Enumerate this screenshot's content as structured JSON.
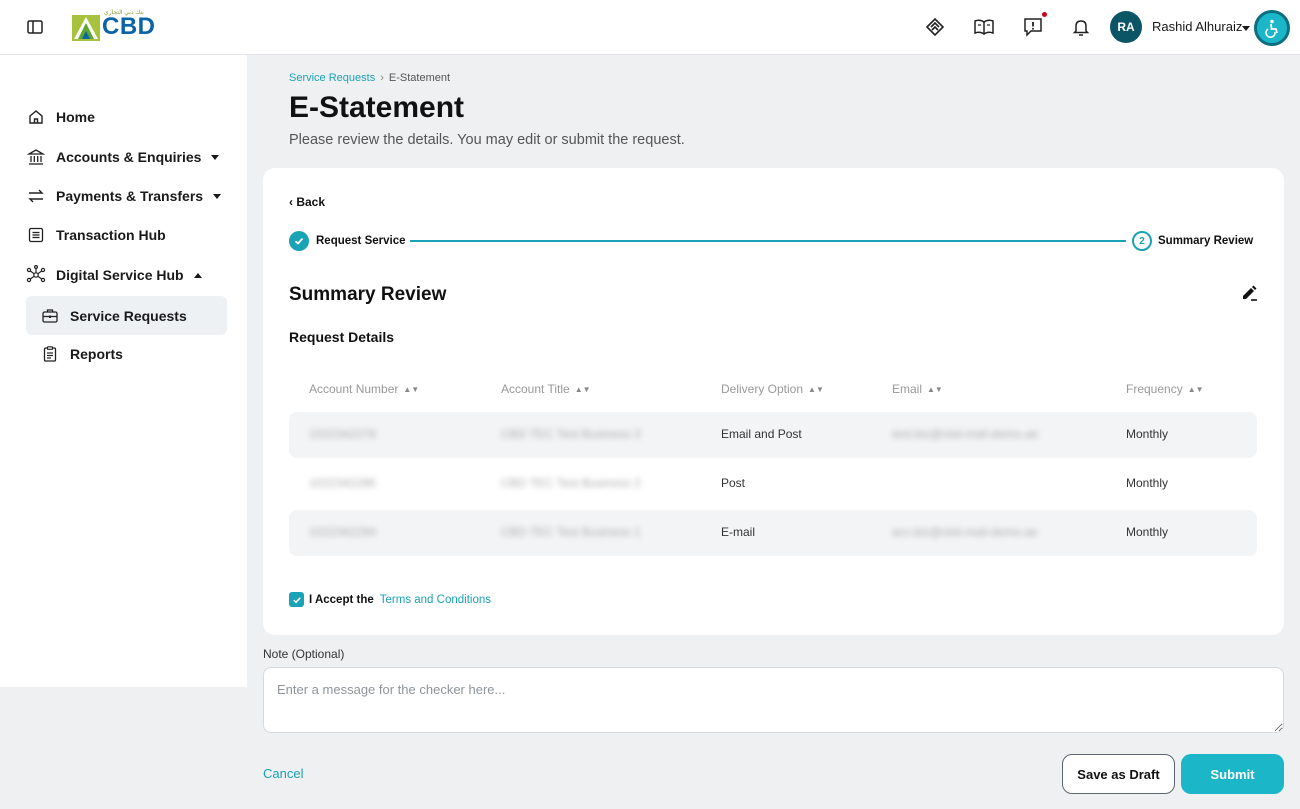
{
  "header": {
    "logo_text": "CBD",
    "logo_subtext": "بنك دبي التجاري",
    "user_initials": "RA",
    "user_name": "Rashid Alhuraiz",
    "icons": [
      "sidebar-toggle-icon",
      "handshake-icon",
      "book-icon",
      "feedback-icon",
      "bell-icon",
      "accessibility-icon"
    ]
  },
  "sidebar": {
    "items": [
      {
        "label": "Home",
        "icon": "home-icon"
      },
      {
        "label": "Accounts & Enquiries",
        "icon": "bank-icon",
        "expandable": true
      },
      {
        "label": "Payments & Transfers",
        "icon": "transfer-icon",
        "expandable": true
      },
      {
        "label": "Transaction Hub",
        "icon": "list-icon"
      },
      {
        "label": "Digital Service Hub",
        "icon": "network-icon",
        "expanded": true
      },
      {
        "label": "Service Requests",
        "icon": "briefcase-icon",
        "active": true
      },
      {
        "label": "Reports",
        "icon": "clipboard-icon"
      }
    ]
  },
  "breadcrumb": {
    "parent": "Service Requests",
    "separator": "›",
    "current": "E-Statement"
  },
  "page": {
    "title": "E-Statement",
    "subtitle": "Please review the details. You may edit or submit the request."
  },
  "card": {
    "back_label": "‹ Back",
    "stepper": {
      "step1_label": "Request Service",
      "step2_number": "2",
      "step2_label": "Summary Review"
    },
    "section_title": "Summary Review",
    "sub_title": "Request Details",
    "table": {
      "headers": [
        "Account Number",
        "Account Title",
        "Delivery Option",
        "Email",
        "Frequency"
      ],
      "rows": [
        [
          "1022342278",
          "CBD TEC Test Business 3",
          "Email and Post",
          "test.biz@cbd-mail-demo.ae",
          "Monthly"
        ],
        [
          "1022342286",
          "CBD TEC Test Business 2",
          "Post",
          "",
          "Monthly"
        ],
        [
          "1022342294",
          "CBD TEC Test Business 1",
          "E-mail",
          "acc.biz@cbd-mail-demo.ae",
          "Monthly"
        ]
      ]
    },
    "accept_label": "I Accept the",
    "terms_link": "Terms and Conditions"
  },
  "note": {
    "label": "Note (Optional)",
    "placeholder": "Enter a message for the checker here...",
    "value": ""
  },
  "actions": {
    "cancel": "Cancel",
    "save_draft": "Save as Draft",
    "submit": "Submit"
  },
  "colors": {
    "accent": "#1aa2b5",
    "submit_bg": "#1bb7c8",
    "avatar_bg": "#0b5566"
  }
}
